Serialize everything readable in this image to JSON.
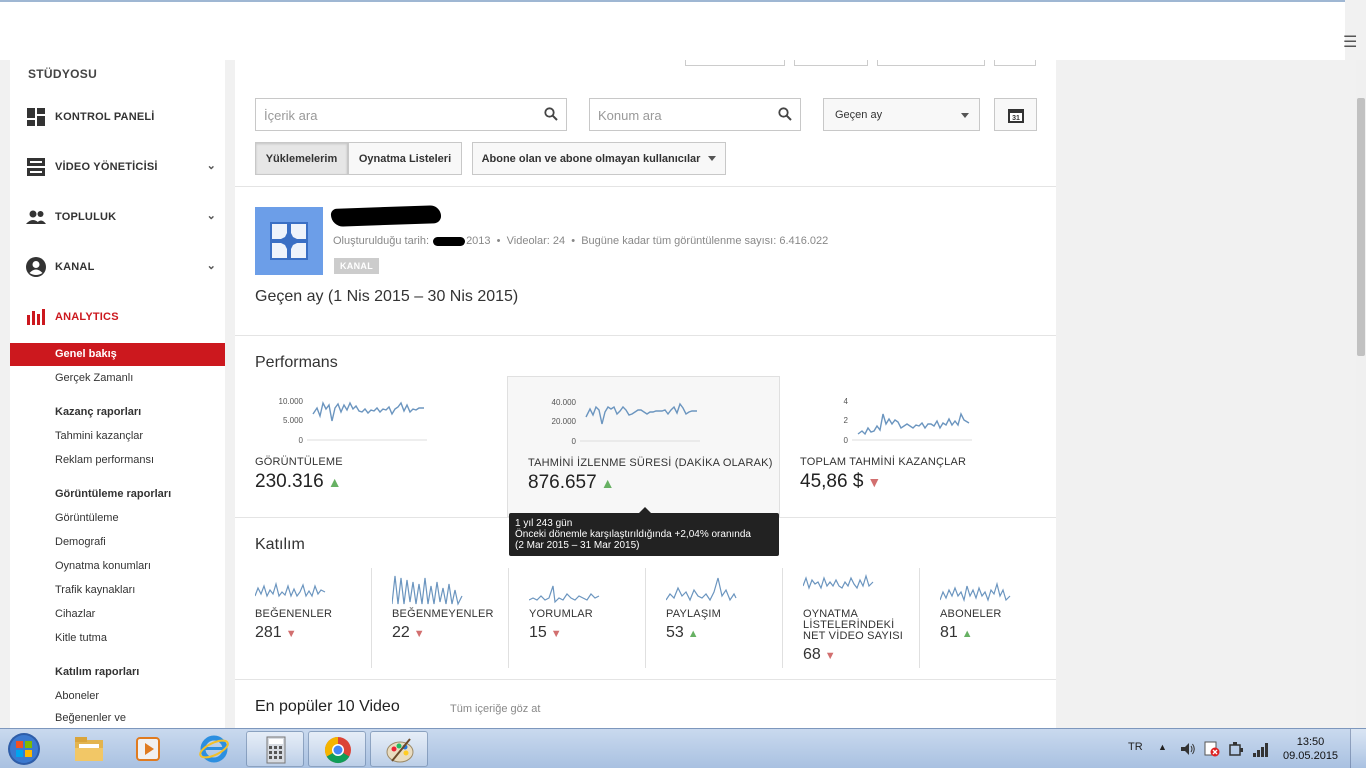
{
  "sidebar": {
    "studio_title": "STÜDYOSU",
    "nav": [
      {
        "label": "KONTROL PANELİ",
        "icon": "dashboard-icon"
      },
      {
        "label": "VİDEO YÖNETİCİSİ",
        "icon": "video-manager-icon"
      },
      {
        "label": "TOPLULUK",
        "icon": "community-icon"
      },
      {
        "label": "KANAL",
        "icon": "channel-icon"
      },
      {
        "label": "ANALYTICS",
        "icon": "analytics-icon"
      }
    ],
    "active_sub": "Genel bakış",
    "subs": {
      "realtime": "Gerçek Zamanlı",
      "earnings_head": "Kazanç raporları",
      "est_earnings": "Tahmini kazançlar",
      "ad_perf": "Reklam performansı",
      "watch_head": "Görüntüleme raporları",
      "views": "Görüntüleme",
      "demographics": "Demografi",
      "playback": "Oynatma konumları",
      "traffic": "Trafik kaynakları",
      "devices": "Cihazlar",
      "retention": "Kitle tutma",
      "engagement_head": "Katılım raporları",
      "subscribers": "Aboneler",
      "likes": "Beğenenler ve"
    }
  },
  "filters": {
    "content_search_placeholder": "İçerik ara",
    "location_search_placeholder": "Konum ara",
    "period": "Geçen ay",
    "calendar_day": "31",
    "uploads": "Yüklemelerim",
    "playlists": "Oynatma Listeleri",
    "subscriber_filter": "Abone olan ve abone olmayan kullanıcılar"
  },
  "channel": {
    "created_label": "Oluşturulduğu tarih:",
    "created_year": "2013",
    "videos": "Videolar: 24",
    "total_views": "Bugüne kadar tüm görüntülenme sayısı: 6.416.022",
    "badge": "KANAL",
    "range": "Geçen ay (1 Nis 2015 – 30 Nis 2015)"
  },
  "performance": {
    "title": "Performans",
    "cards": [
      {
        "label": "GÖRÜNTÜLEME",
        "value": "230.316",
        "trend": "up",
        "ticks": [
          "10.000",
          "5.000",
          "0"
        ]
      },
      {
        "label": "TAHMİNİ İZLENME SÜRESİ (DAKİKA OLARAK)",
        "value": "876.657",
        "trend": "up",
        "ticks": [
          "40.000",
          "20.000",
          "0"
        ]
      },
      {
        "label": "TOPLAM TAHMİNİ KAZANÇLAR",
        "value": "45,86 $",
        "trend": "down",
        "ticks": [
          "4",
          "2",
          "0"
        ]
      }
    ],
    "tooltip": {
      "line1": "1 yıl 243 gün",
      "line2": "Önceki dönemle karşılaştırıldığında +2,04% oranında",
      "line3": "(2 Mar 2015 – 31 Mar 2015)"
    }
  },
  "engagement": {
    "title": "Katılım",
    "cards": [
      {
        "label": "BEĞENENLER",
        "value": "281",
        "trend": "down"
      },
      {
        "label": "BEĞENMEYENLER",
        "value": "22",
        "trend": "down"
      },
      {
        "label": "YORUMLAR",
        "value": "15",
        "trend": "down"
      },
      {
        "label": "PAYLAŞIM",
        "value": "53",
        "trend": "up"
      },
      {
        "label": "OYNATMA LİSTELERİNDEKİ NET VİDEO SAYISI",
        "value": "68",
        "trend": "down"
      },
      {
        "label": "ABONELER",
        "value": "81",
        "trend": "up"
      }
    ]
  },
  "top_videos": {
    "title": "En popüler 10 Video",
    "see_all": "Tüm içeriğe göz at"
  },
  "taskbar": {
    "lang": "TR",
    "time": "13:50",
    "date": "09.05.2015"
  },
  "colors": {
    "accent_red": "#cc181e",
    "spark_blue": "#6b95bf",
    "up_green": "#67b163",
    "down_red": "#d26f6f"
  }
}
